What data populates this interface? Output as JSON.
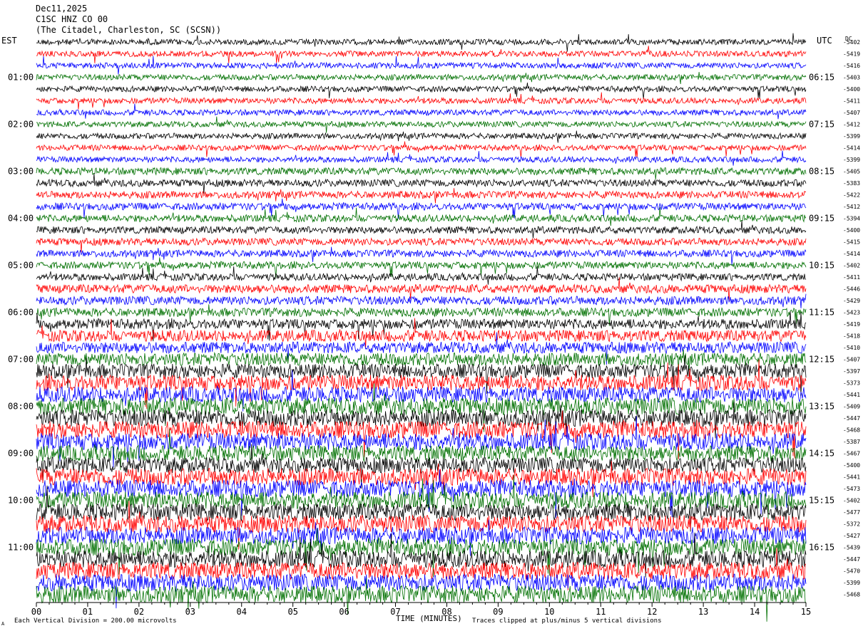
{
  "header": {
    "date": "Dec11,2025",
    "station": "C1SC HNZ CO 00",
    "location": "(The Citadel, Charleston, SC (SCSN))"
  },
  "axis": {
    "left_tz": "EST",
    "right_tz": "UTC",
    "dc_label": "DC",
    "xlabel": "TIME (MINUTES)"
  },
  "footer": {
    "scale_note": "Each Vertical Division = 200.00 microvolts",
    "clip_note": "Traces clipped at plus/minus 5 vertical divisions",
    "small_mark": "A"
  },
  "colors": {
    "trace_cycle": [
      "#000000",
      "#ff0000",
      "#0000ff",
      "#007000"
    ],
    "text": "#000000",
    "background": "#ffffff"
  },
  "chart_data": {
    "type": "line",
    "title": "",
    "xlim": [
      0,
      15
    ],
    "x_tick_labels": [
      "00",
      "01",
      "02",
      "03",
      "04",
      "05",
      "06",
      "07",
      "08",
      "09",
      "10",
      "11",
      "12",
      "13",
      "14",
      "15"
    ],
    "trace_count": 48,
    "trace_span_minutes": 15,
    "first_trace_start_est": "00:15",
    "left_time_labels": [
      "01:00",
      "02:00",
      "03:00",
      "04:00",
      "05:00",
      "06:00",
      "07:00",
      "08:00",
      "09:00",
      "10:00",
      "11:00"
    ],
    "right_time_labels": [
      "06:15",
      "07:15",
      "08:15",
      "09:15",
      "10:15",
      "11:15",
      "12:15",
      "13:15",
      "14:15",
      "15:15",
      "16:15"
    ],
    "dc_offsets": [
      -5402,
      -5419,
      -5416,
      -5403,
      -5400,
      -5411,
      -5407,
      -5412,
      -5399,
      -5414,
      -5399,
      -5405,
      -5383,
      -5422,
      -5412,
      -5394,
      -5400,
      -5415,
      -5414,
      -5402,
      -5411,
      -5446,
      -5429,
      -5423,
      -5419,
      -5418,
      -5410,
      -5407,
      -5397,
      -5373,
      -5441,
      -5409,
      -5447,
      -5468,
      -5387,
      -5467,
      -5400,
      -5441,
      -5473,
      -5402,
      -5477,
      -5372,
      -5427,
      -5439,
      -5447,
      -5470,
      -5399,
      -5468
    ],
    "noise_amplitude": [
      4,
      4,
      4,
      4,
      4,
      4,
      4,
      4,
      4,
      4,
      4,
      5,
      5,
      5,
      5,
      5,
      5,
      5,
      5,
      5,
      5,
      6,
      6,
      6,
      7,
      8,
      8,
      9,
      10,
      11,
      11,
      12,
      12,
      12,
      12,
      11,
      11,
      12,
      12,
      12,
      12,
      12,
      12,
      12,
      12,
      12,
      12,
      12
    ]
  }
}
